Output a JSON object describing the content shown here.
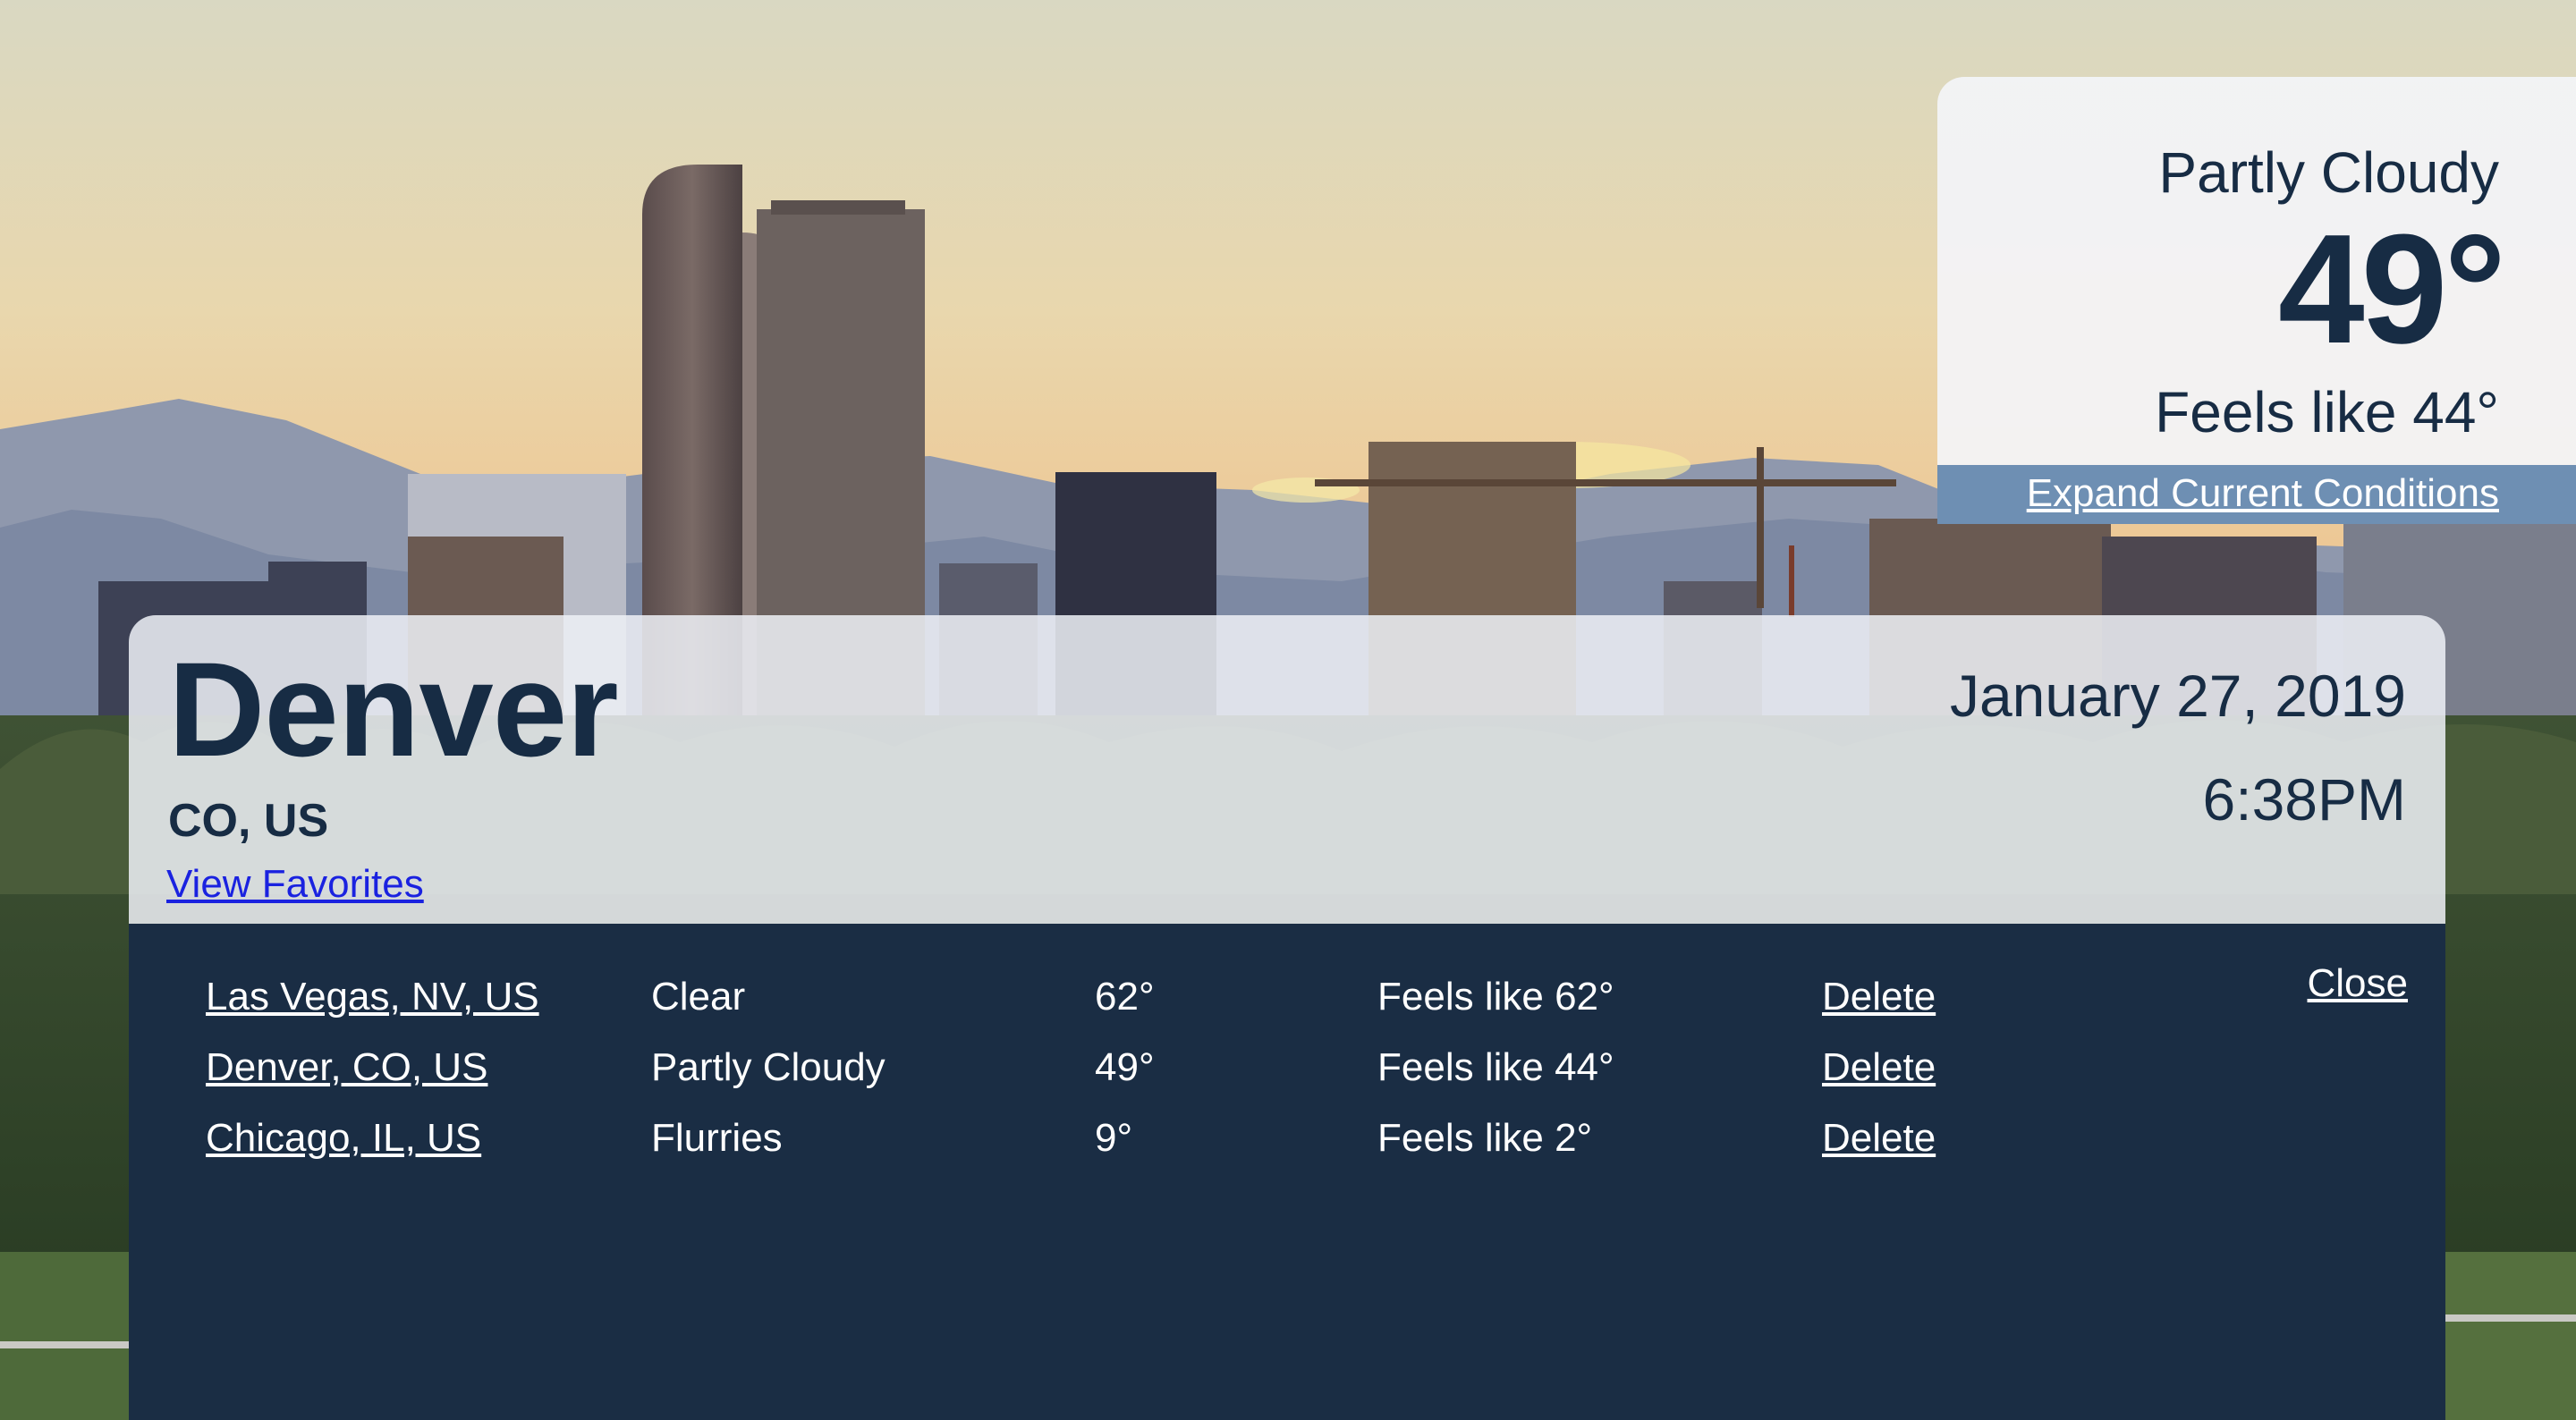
{
  "current": {
    "condition": "Partly Cloudy",
    "temperature": "49°",
    "feels_like": "Feels like 44°",
    "expand_label": "Expand Current Conditions"
  },
  "location": {
    "city": "Denver",
    "region": "CO, US",
    "favorites_link": "View Favorites",
    "date": "January 27, 2019",
    "time": "6:38PM"
  },
  "favorites": {
    "close_label": "Close",
    "rows": [
      {
        "location": "Las Vegas, NV, US",
        "condition": "Clear",
        "temperature": "62°",
        "feels_like": "Feels like 62°",
        "delete_label": "Delete"
      },
      {
        "location": "Denver, CO, US",
        "condition": "Partly Cloudy",
        "temperature": "49°",
        "feels_like": "Feels like 44°",
        "delete_label": "Delete"
      },
      {
        "location": "Chicago, IL, US",
        "condition": "Flurries",
        "temperature": "9°",
        "feels_like": "Feels like 2°",
        "delete_label": "Delete"
      }
    ]
  },
  "colors": {
    "navy": "#1a2d44",
    "text": "#172c44",
    "expand_bar": "#6e8fb3",
    "link": "#1a22e0"
  }
}
